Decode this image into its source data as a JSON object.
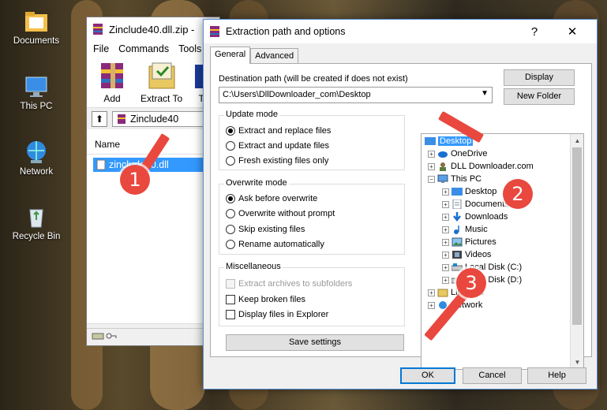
{
  "desktop": {
    "icons": [
      {
        "label": "Documents"
      },
      {
        "label": "This PC"
      },
      {
        "label": "Network"
      },
      {
        "label": "Recycle Bin"
      }
    ]
  },
  "winrar": {
    "title": "Zinclude40.dll.zip -",
    "menu": [
      "File",
      "Commands",
      "Tools"
    ],
    "toolbar": {
      "add": "Add",
      "extract_to": "Extract To",
      "partial": "T"
    },
    "address": "Zinclude40",
    "column_name": "Name",
    "file": "zinclude40.dll",
    "scroll_left": "◀"
  },
  "dialog": {
    "title": "Extraction path and options",
    "help_btn": "?",
    "close_btn": "✕",
    "tabs": [
      "General",
      "Advanced"
    ],
    "dest_label": "Destination path (will be created if does not exist)",
    "dest_value": "C:\\Users\\DllDownloader_com\\Desktop",
    "display_btn": "Display",
    "new_folder_btn": "New Folder",
    "update_mode": {
      "title": "Update mode",
      "options": [
        "Extract and replace files",
        "Extract and update files",
        "Fresh existing files only"
      ],
      "selected": 0
    },
    "overwrite_mode": {
      "title": "Overwrite mode",
      "options": [
        "Ask before overwrite",
        "Overwrite without prompt",
        "Skip existing files",
        "Rename automatically"
      ],
      "selected": 0
    },
    "misc": {
      "title": "Miscellaneous",
      "options": [
        "Extract archives to subfolders",
        "Keep broken files",
        "Display files in Explorer"
      ]
    },
    "save_settings": "Save settings",
    "tree": [
      "Desktop",
      "OneDrive",
      "DLL Downloader.com",
      "This PC",
      "Desktop",
      "Documents",
      "Downloads",
      "Music",
      "Pictures",
      "Videos",
      "Local Disk (C:)",
      "Local Disk (D:)",
      "Libraries",
      "Network"
    ],
    "ok": "OK",
    "cancel": "Cancel",
    "help": "Help"
  },
  "annotations": {
    "step1": "1",
    "step2": "2",
    "step3": "3"
  },
  "colors": {
    "accent": "#3399ff",
    "annotation": "#e9483f"
  }
}
